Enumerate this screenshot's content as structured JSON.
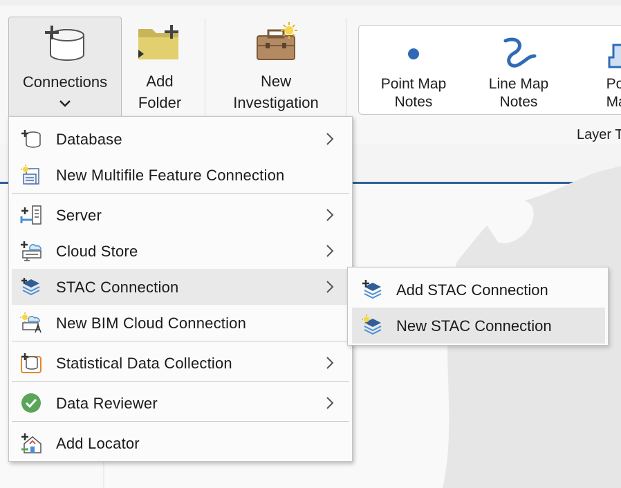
{
  "ribbon": {
    "connections": {
      "label": "Connections",
      "chevron": "⌄",
      "icon": "database-add-icon"
    },
    "add_folder": {
      "line1": "Add",
      "line2": "Folder",
      "icon": "folder-add-icon"
    },
    "new_investigation": {
      "line1": "New",
      "line2": "Investigation",
      "icon": "briefcase-new-icon"
    },
    "gallery": [
      {
        "line1": "Point Map",
        "line2": "Notes",
        "icon": "point-icon"
      },
      {
        "line1": "Line Map",
        "line2": "Notes",
        "icon": "line-icon"
      },
      {
        "line1": "Poly",
        "line2": "Map",
        "icon": "polygon-icon"
      }
    ],
    "group_label": "Layer T"
  },
  "menu": {
    "items": [
      {
        "label": "Database",
        "icon": "database-add-icon",
        "submenu": true
      },
      {
        "label": "New Multifile Feature Connection",
        "icon": "multifile-connection-new-icon",
        "submenu": false
      },
      {
        "label": "Server",
        "icon": "server-add-icon",
        "submenu": true
      },
      {
        "label": "Cloud Store",
        "icon": "cloud-store-add-icon",
        "submenu": true
      },
      {
        "label": "STAC Connection",
        "icon": "stac-layers-icon",
        "submenu": true,
        "highlighted": true
      },
      {
        "label": "New BIM Cloud Connection",
        "icon": "bim-cloud-new-icon",
        "submenu": false
      },
      {
        "label": "Statistical Data Collection",
        "icon": "statistical-data-icon",
        "submenu": true
      },
      {
        "label": "Data Reviewer",
        "icon": "check-circle-icon",
        "submenu": true
      },
      {
        "label": "Add Locator",
        "icon": "locator-add-icon",
        "submenu": false
      }
    ]
  },
  "submenu": {
    "items": [
      {
        "label": "Add STAC Connection",
        "icon": "stac-add-icon"
      },
      {
        "label": "New STAC Connection",
        "icon": "stac-new-icon",
        "highlighted": true
      }
    ]
  },
  "colors": {
    "accent_blue": "#2f5e99",
    "highlight": "#e9e9e9",
    "check_green": "#5aa55a"
  }
}
